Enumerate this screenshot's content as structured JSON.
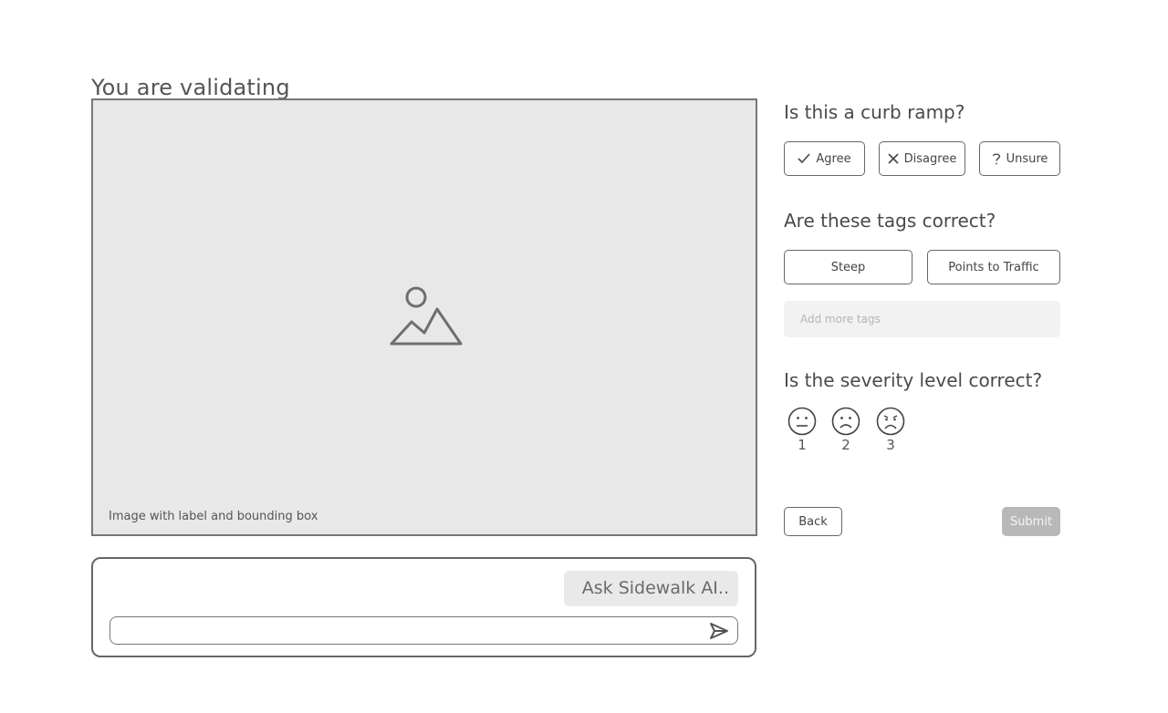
{
  "page": {
    "title": "You are validating"
  },
  "image_panel": {
    "caption": "Image with label and bounding box",
    "icon": "image-placeholder-icon"
  },
  "chat": {
    "ask_label": "Ask Sidewalk AI..",
    "input_value": "",
    "send_icon": "send-icon"
  },
  "question_curb": {
    "title": "Is this a curb ramp?",
    "options": [
      {
        "label": "Agree",
        "icon": "check-icon"
      },
      {
        "label": "Disagree",
        "icon": "x-icon"
      },
      {
        "label": "Unsure",
        "icon": "question-icon"
      }
    ]
  },
  "question_tags": {
    "title": "Are these tags correct?",
    "tags": [
      "Steep",
      "Points to Traffic"
    ],
    "add_placeholder": "Add more tags"
  },
  "question_severity": {
    "title": "Is the severity level correct?",
    "levels": [
      {
        "number": "1",
        "icon": "neutral-face-icon"
      },
      {
        "number": "2",
        "icon": "sad-face-icon"
      },
      {
        "number": "3",
        "icon": "frown-face-icon"
      }
    ]
  },
  "actions": {
    "back": "Back",
    "submit": "Submit"
  },
  "colors": {
    "panel_bg": "#e8e8e8",
    "border": "#666666",
    "submit_bg": "#b8b8b8",
    "text": "#4a4a4a"
  }
}
